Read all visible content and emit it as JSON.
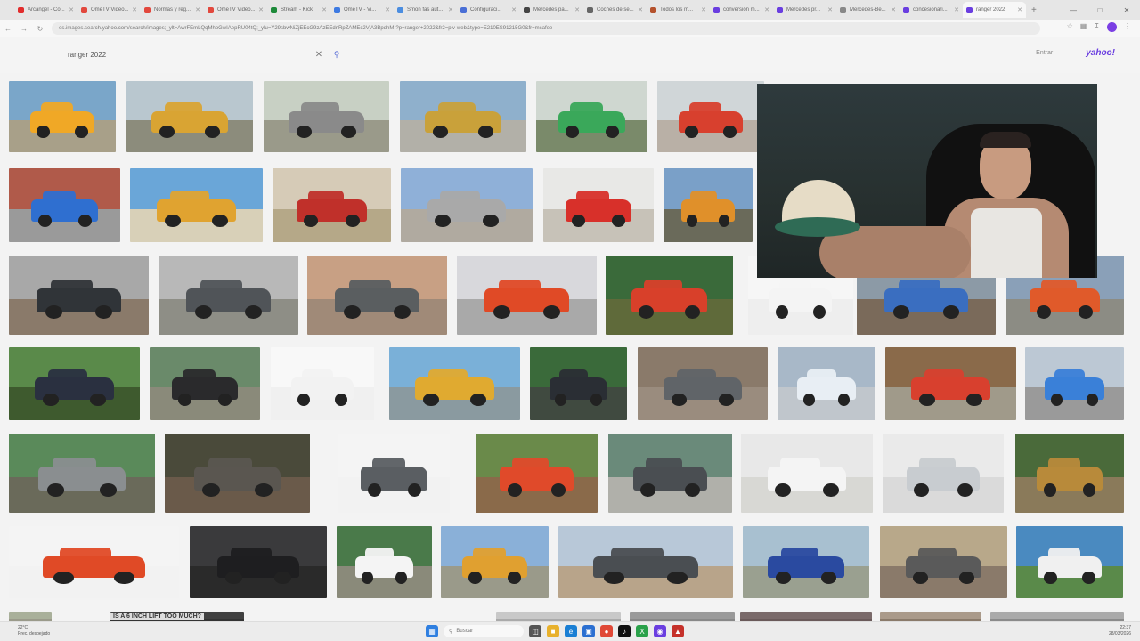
{
  "browser": {
    "tabs": [
      {
        "label": "Arcangel - Co...",
        "color": "#e22d2d",
        "active": false
      },
      {
        "label": "OmeTV Video...",
        "color": "#e2483d",
        "active": false
      },
      {
        "label": "Normas y reg...",
        "color": "#e2483d",
        "active": false
      },
      {
        "label": "OmeTV Video...",
        "color": "#e2483d",
        "active": false
      },
      {
        "label": "Stream - Kick",
        "color": "#1e8a3a",
        "active": false
      },
      {
        "label": "OmeTV - Vi...",
        "color": "#3d7ae2",
        "active": false
      },
      {
        "label": "Smon fas aut...",
        "color": "#4b8de0",
        "active": false
      },
      {
        "label": "Configuraci...",
        "color": "#4a6fd6",
        "active": false
      },
      {
        "label": "Mercedes pa...",
        "color": "#444444",
        "active": false
      },
      {
        "label": "Coches de se...",
        "color": "#666666",
        "active": false
      },
      {
        "label": "Todos los m...",
        "color": "#b5522d",
        "active": false
      },
      {
        "label": "conversión m...",
        "color": "#6a3ee0",
        "active": false
      },
      {
        "label": "Mercedes pr...",
        "color": "#6a3ee0",
        "active": false
      },
      {
        "label": "Mercedes-Be...",
        "color": "#888888",
        "active": false
      },
      {
        "label": "concesionari...",
        "color": "#6a3ee0",
        "active": false
      },
      {
        "label": "ranger 2022",
        "color": "#6a3ee0",
        "active": true
      }
    ],
    "url": "es.images.search.yahoo.com/search/images;_ylt=AwrFEmLQqMhpGwIAepRU04tQ;_ylu=Y29sbwNiZjEEcG9zAzEEdnRpZAMEc2VjA3BpdnM-?p=ranger+2022&fr2=piv-web&type=E210ES91215G0&fr=mcafee"
  },
  "yahoo": {
    "query": "ranger 2022",
    "signin_label": "Entrar",
    "logo": "yahoo!"
  },
  "overlay_caption": "IS A 6 INCH LIFT TOO MUCH?",
  "taskbar": {
    "weather_temp": "22°C",
    "weather_desc": "Prec. despejado",
    "search_placeholder": "Buscar",
    "time": "22:37",
    "date": "28/03/2026"
  }
}
